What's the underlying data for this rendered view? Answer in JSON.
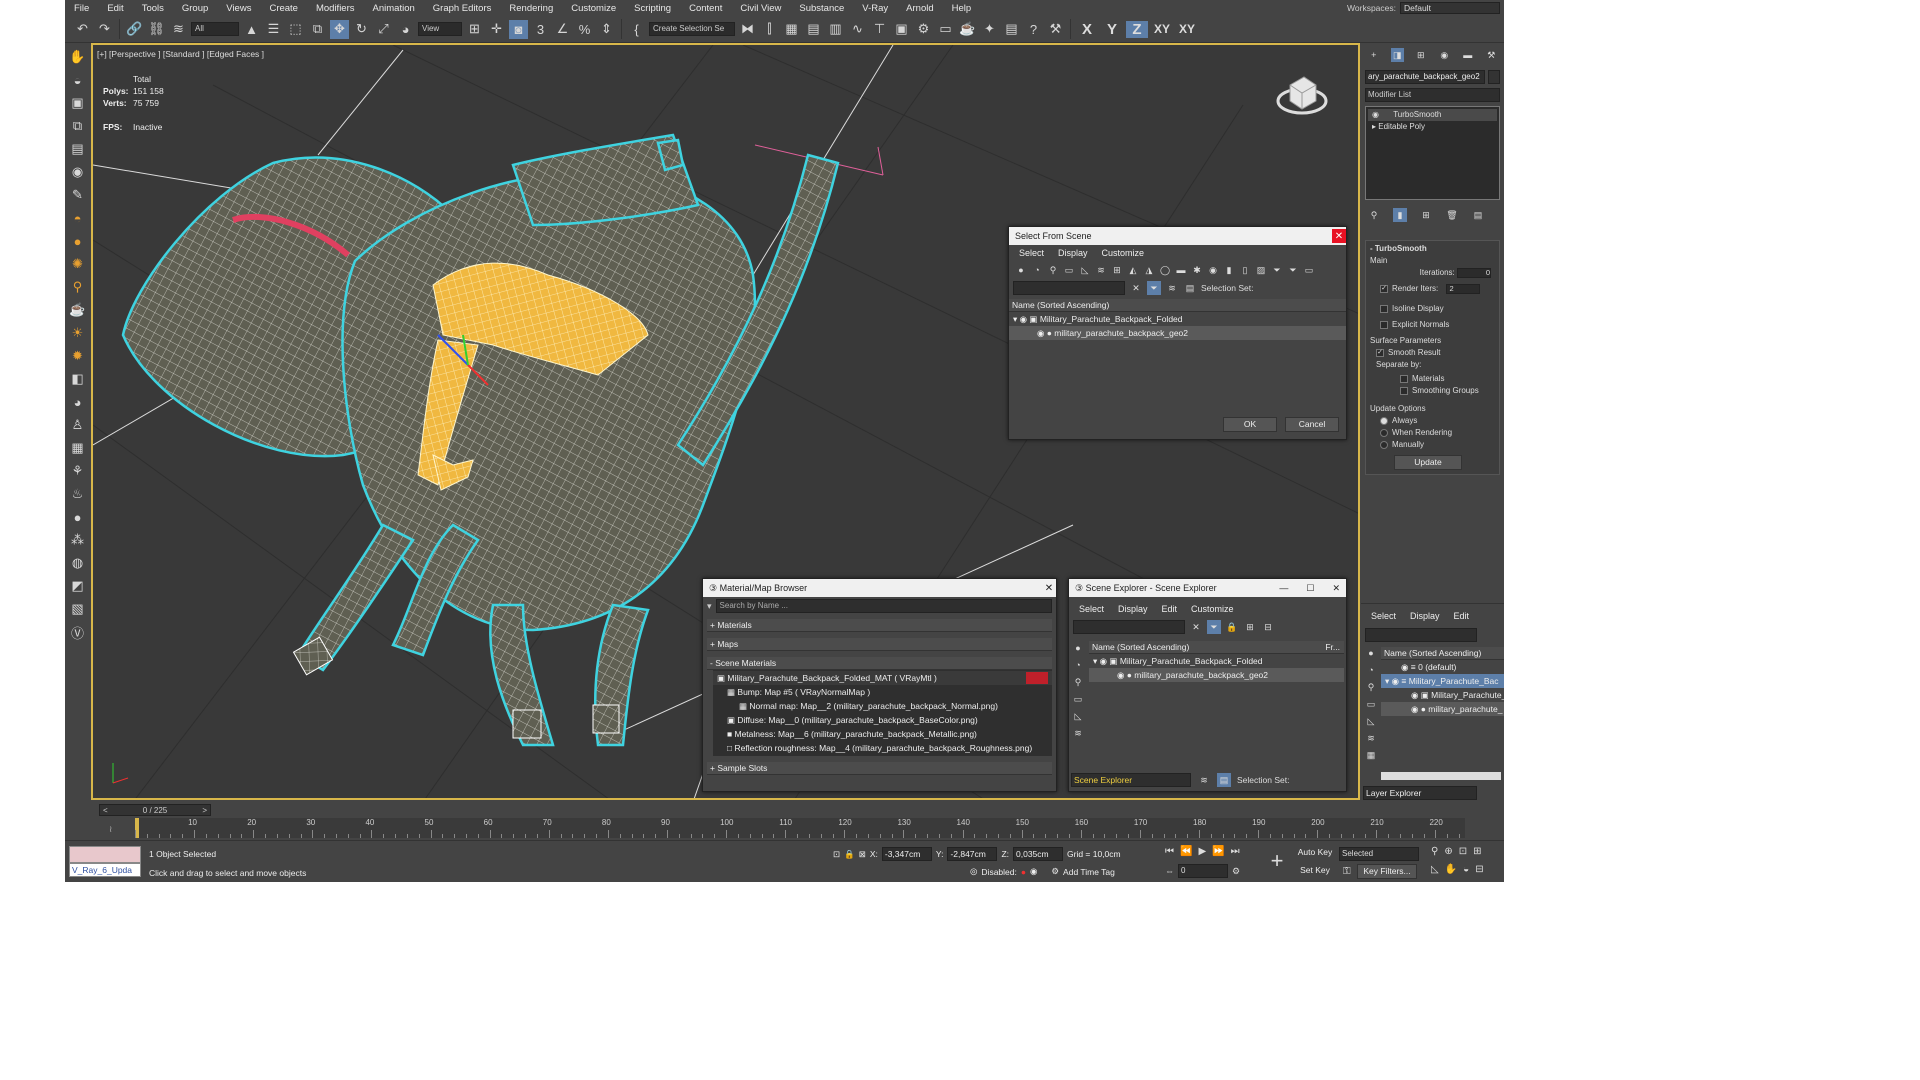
{
  "menu": [
    "File",
    "Edit",
    "Tools",
    "Group",
    "Views",
    "Create",
    "Modifiers",
    "Animation",
    "Graph Editors",
    "Rendering",
    "Customize",
    "Scripting",
    "Content",
    "Civil View",
    "Substance",
    "V-Ray",
    "Arnold",
    "Help"
  ],
  "workspaces": {
    "label": "Workspaces:",
    "value": "Default"
  },
  "toolbar": {
    "filter_dd": "All",
    "view_dd": "View",
    "selset_dd": "Create Selection Se",
    "axes": [
      "X",
      "Y",
      "Z",
      "XY",
      "XY"
    ]
  },
  "viewport": {
    "label": "[+] [Perspective ] [Standard ] [Edged Faces ]",
    "stats": {
      "total": "Total",
      "polys_label": "Polys:",
      "polys": "151 158",
      "verts_label": "Verts:",
      "verts": "75 759",
      "fps_label": "FPS:",
      "fps": "Inactive"
    }
  },
  "select_from_scene": {
    "title": "Select From Scene",
    "menu": [
      "Select",
      "Display",
      "Customize"
    ],
    "selection_set": "Selection Set:",
    "column": "Name (Sorted Ascending)",
    "rows": [
      "Military_Parachute_Backpack_Folded",
      "military_parachute_backpack_geo2"
    ],
    "ok": "OK",
    "cancel": "Cancel"
  },
  "material_browser": {
    "title": "Material/Map Browser",
    "search": "Search by Name ...",
    "sections": [
      "+ Materials",
      "+ Maps",
      "- Scene Materials",
      "+ Sample Slots"
    ],
    "items": [
      "Military_Parachute_Backpack_Folded_MAT  ( VRayMtl )",
      "Bump: Map #5  ( VRayNormalMap )",
      "Normal map: Map__2 (military_parachute_backpack_Normal.png)",
      "Diffuse: Map__0 (military_parachute_backpack_BaseColor.png)",
      "Metalness: Map__6 (military_parachute_backpack_Metallic.png)",
      "Reflection roughness: Map__4 (military_parachute_backpack_Roughness.png)"
    ]
  },
  "scene_explorer": {
    "title": "Scene Explorer - Scene Explorer",
    "menu": [
      "Select",
      "Display",
      "Edit",
      "Customize"
    ],
    "column": "Name (Sorted Ascending)",
    "column2": "Fr...",
    "rows": [
      "Military_Parachute_Backpack_Folded",
      "military_parachute_backpack_geo2"
    ],
    "footer_dd": "Scene Explorer",
    "selection_set": "Selection Set:"
  },
  "command_panel": {
    "object_name": "ary_parachute_backpack_geo2",
    "modifier_list": "Modifier List",
    "stack": [
      "TurboSmooth",
      "Editable Poly"
    ],
    "turbosmooth": {
      "title": "TurboSmooth",
      "main": "Main",
      "iterations_label": "Iterations:",
      "iterations": "0",
      "render_iters_label": "Render Iters:",
      "render_iters": "2",
      "isoline": "Isoline Display",
      "explicit": "Explicit Normals",
      "surface": "Surface Parameters",
      "smooth": "Smooth Result",
      "separate": "Separate by:",
      "materials": "Materials",
      "smoothing_groups": "Smoothing Groups",
      "update_options": "Update Options",
      "always": "Always",
      "when_rendering": "When Rendering",
      "manually": "Manually",
      "update_btn": "Update"
    }
  },
  "layer_explorer": {
    "menu": [
      "Select",
      "Display",
      "Edit"
    ],
    "column": "Name (Sorted Ascending)",
    "rows": [
      "0 (default)",
      "Military_Parachute_Bac",
      "Military_Parachute_",
      "military_parachute_"
    ],
    "footer": "Layer Explorer"
  },
  "timeline": {
    "slider": "0 / 225",
    "ticks": [
      "10",
      "20",
      "30",
      "40",
      "50",
      "60",
      "70",
      "80",
      "90",
      "100",
      "110",
      "120",
      "130",
      "140",
      "150",
      "160",
      "170",
      "180",
      "190",
      "200",
      "210",
      "220"
    ]
  },
  "status": {
    "script_box": "V_Ray_6_Upda",
    "selected": "1 Object Selected",
    "hint": "Click and drag to select and move objects",
    "x_label": "X:",
    "x": "-3,347cm",
    "y_label": "Y:",
    "y": "-2,847cm",
    "z_label": "Z:",
    "z": "0,035cm",
    "grid": "Grid = 10,0cm",
    "disabled": "Disabled:",
    "add_time_tag": "Add Time Tag",
    "auto_key": "Auto Key",
    "set_key": "Set Key",
    "selected_dd": "Selected",
    "key_filters": "Key Filters...",
    "frame": "0"
  },
  "colors": {
    "selection_cyan": "#3fd3e0",
    "highlight_yellow": "#e8b930",
    "active_blue": "#5d7fa9",
    "mesh_olive": "#5f5f52"
  }
}
